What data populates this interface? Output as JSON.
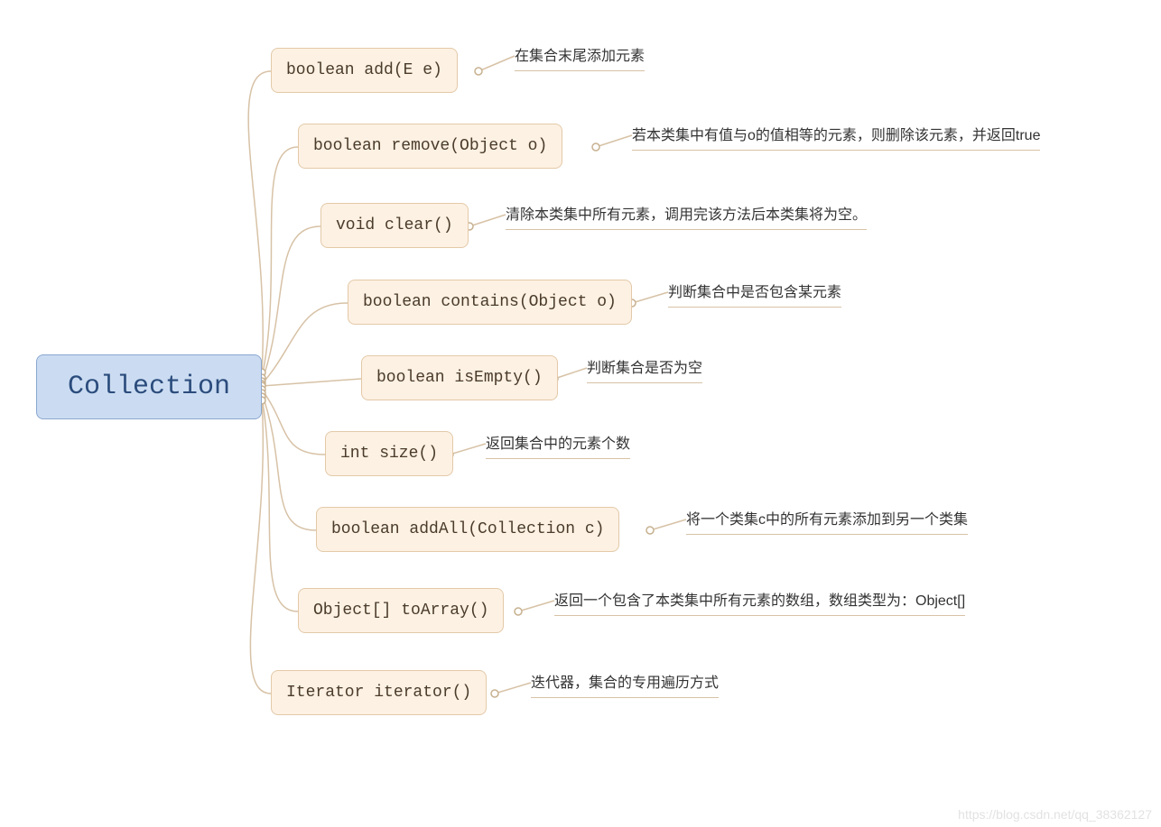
{
  "root": {
    "label": "Collection"
  },
  "methods": [
    {
      "label": "boolean add(E e)",
      "desc": "在集合末尾添加元素"
    },
    {
      "label": "boolean remove(Object o)",
      "desc": "若本类集中有值与o的值相等的元素，则删除该元素，并返回true"
    },
    {
      "label": "void clear()",
      "desc": "清除本类集中所有元素，调用完该方法后本类集将为空。"
    },
    {
      "label": "boolean contains(Object o)",
      "desc": "判断集合中是否包含某元素"
    },
    {
      "label": "boolean isEmpty()",
      "desc": "判断集合是否为空"
    },
    {
      "label": "int size()",
      "desc": "返回集合中的元素个数"
    },
    {
      "label": "boolean addAll(Collection c)",
      "desc": "将一个类集c中的所有元素添加到另一个类集"
    },
    {
      "label": "Object[] toArray()",
      "desc": "返回一个包含了本类集中所有元素的数组，数组类型为：Object[]"
    },
    {
      "label": "Iterator iterator()",
      "desc": "迭代器，集合的专用遍历方式"
    }
  ],
  "watermark": "https://blog.csdn.net/qq_38362127"
}
